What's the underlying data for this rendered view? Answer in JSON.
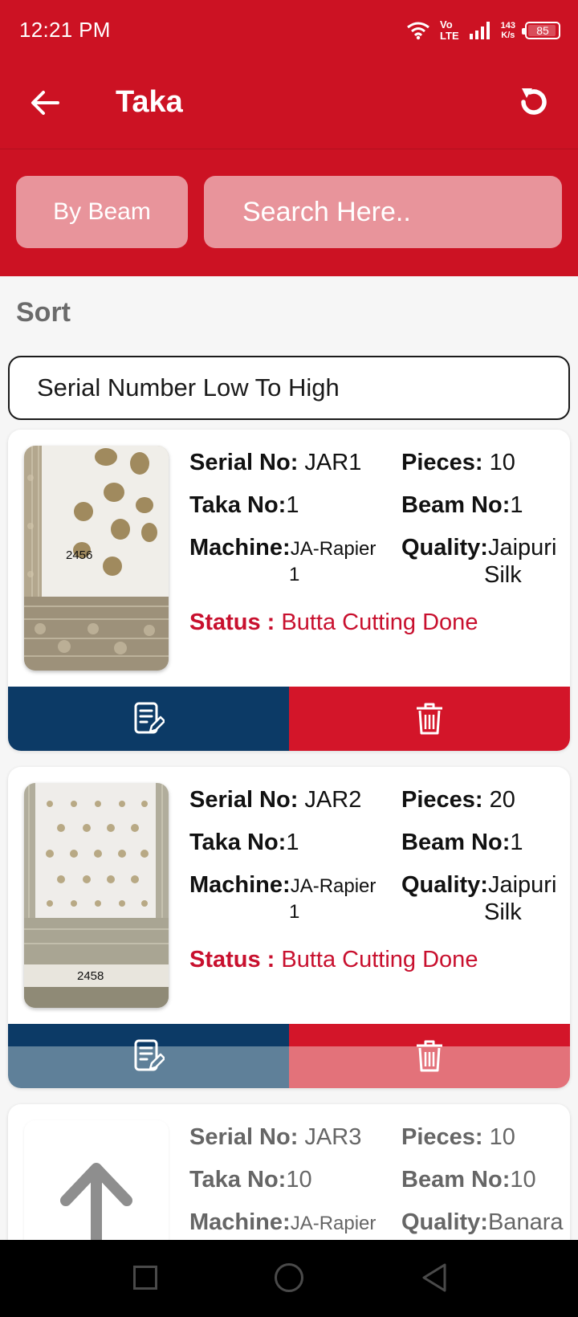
{
  "status_bar": {
    "time": "12:21 PM",
    "volte_top": "Vo",
    "volte_bottom": "LTE",
    "speed_top": "143",
    "speed_bottom": "K/s",
    "battery": "85",
    "battery_level": 0.85
  },
  "header": {
    "title": "Taka",
    "back_icon": "arrow-left-icon",
    "refresh_icon": "refresh-icon"
  },
  "filters": {
    "by_beam_label": "By Beam",
    "search_placeholder": "Search Here.."
  },
  "sort": {
    "label": "Sort",
    "selected": "Serial Number Low To High"
  },
  "labels": {
    "serial_no": "Serial No:",
    "pieces": "Pieces:",
    "taka_no": "Taka No:",
    "beam_no": "Beam No:",
    "machine": "Machine:",
    "quality": "Quality:",
    "status": "Status :"
  },
  "cards": [
    {
      "thumb_number": "2456",
      "serial_no": " JAR1",
      "pieces": " 10",
      "taka_no": "1",
      "beam_no": "1",
      "machine_1": "JA-Rapier",
      "machine_2": "1",
      "quality_1": "Jaipuri",
      "quality_2": "Silk",
      "status": " Butta Cutting Done"
    },
    {
      "thumb_number": "2458",
      "serial_no": " JAR2",
      "pieces": " 20",
      "taka_no": "1",
      "beam_no": "1",
      "machine_1": "JA-Rapier",
      "machine_2": "1",
      "quality_1": "Jaipuri",
      "quality_2": "Silk",
      "status": " Butta Cutting Done"
    },
    {
      "serial_no": " JAR3",
      "pieces": " 10",
      "taka_no": "10",
      "beam_no": "10",
      "machine_1": "JA-Rapier",
      "quality_1": "Banara"
    }
  ],
  "icons": {
    "edit": "edit-note-icon",
    "delete": "trash-icon",
    "placeholder": "arrow-up-icon"
  },
  "colors": {
    "brand_red": "#cc1223",
    "edit_blue": "#0c3a66",
    "delete_red": "#d31529",
    "status_red": "#c8102e"
  }
}
